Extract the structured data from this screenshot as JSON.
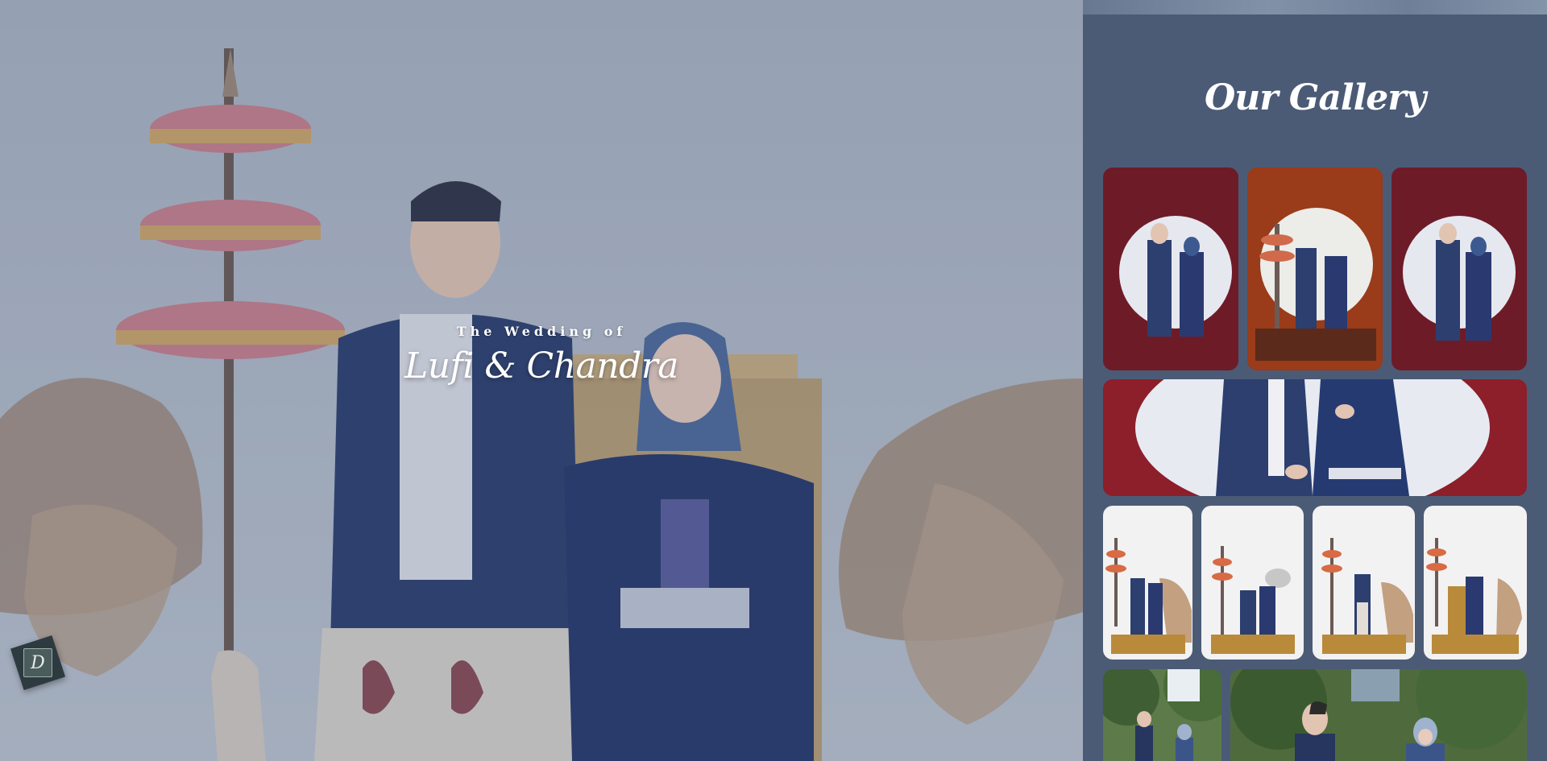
{
  "hero": {
    "kicker": "The Wedding of",
    "names": "Lufi & Chandra"
  },
  "brand_badge": {
    "letter": "D"
  },
  "gallery": {
    "title": "Our Gallery"
  },
  "colors": {
    "panel_bg": "#4b5b76",
    "hero_bg": "#a9b3c3",
    "accent_blue": "#2c3f6e",
    "studio_red": "#7a1f2a"
  }
}
